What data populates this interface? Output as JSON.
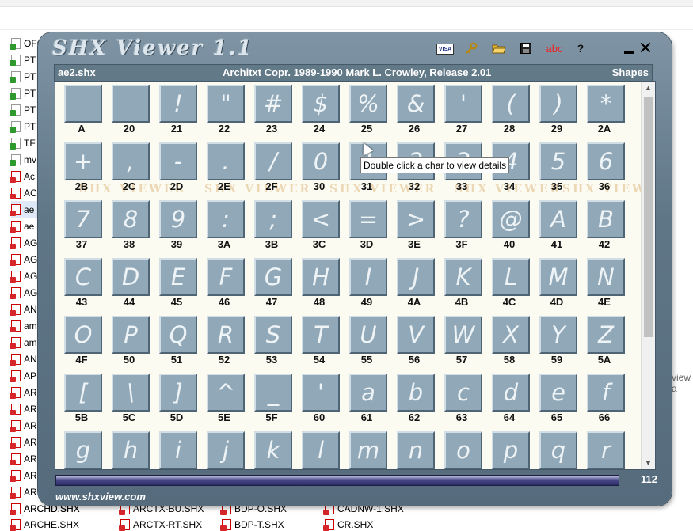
{
  "window": {
    "title": "SHX Viewer 1.1",
    "filename": "ae2.shx",
    "copyright": "Architxt Copr. 1989-1990 Mark L. Crowley, Release 2.01",
    "mode": "Shapes",
    "tooltip": "Double click a char to view details",
    "count": "112",
    "progress_fraction": 1.0,
    "url": "www.shxview.com",
    "watermark": "SHX VIEWER",
    "toolbar": {
      "visa_label": "VISA",
      "key_icon": "key-icon",
      "open_icon": "folder-open-icon",
      "save_icon": "floppy-save-icon",
      "abc_label": "abc",
      "help_label": "?"
    }
  },
  "glyph_cells": [
    {
      "glyph": "",
      "code": "A"
    },
    {
      "glyph": "",
      "code": "20"
    },
    {
      "glyph": "!",
      "code": "21"
    },
    {
      "glyph": "\"",
      "code": "22"
    },
    {
      "glyph": "#",
      "code": "23"
    },
    {
      "glyph": "$",
      "code": "24"
    },
    {
      "glyph": "%",
      "code": "25"
    },
    {
      "glyph": "&",
      "code": "26"
    },
    {
      "glyph": "'",
      "code": "27"
    },
    {
      "glyph": "(",
      "code": "28"
    },
    {
      "glyph": ")",
      "code": "29"
    },
    {
      "glyph": "*",
      "code": "2A"
    },
    {
      "glyph": "+",
      "code": "2B"
    },
    {
      "glyph": ",",
      "code": "2C"
    },
    {
      "glyph": "-",
      "code": "2D"
    },
    {
      "glyph": ".",
      "code": "2E"
    },
    {
      "glyph": "/",
      "code": "2F"
    },
    {
      "glyph": "0",
      "code": "30"
    },
    {
      "glyph": "1",
      "code": "31"
    },
    {
      "glyph": "2",
      "code": "32"
    },
    {
      "glyph": "3",
      "code": "33"
    },
    {
      "glyph": "4",
      "code": "34"
    },
    {
      "glyph": "5",
      "code": "35"
    },
    {
      "glyph": "6",
      "code": "36"
    },
    {
      "glyph": "7",
      "code": "37"
    },
    {
      "glyph": "8",
      "code": "38"
    },
    {
      "glyph": "9",
      "code": "39"
    },
    {
      "glyph": ":",
      "code": "3A"
    },
    {
      "glyph": ";",
      "code": "3B"
    },
    {
      "glyph": "<",
      "code": "3C"
    },
    {
      "glyph": "=",
      "code": "3D"
    },
    {
      "glyph": ">",
      "code": "3E"
    },
    {
      "glyph": "?",
      "code": "3F"
    },
    {
      "glyph": "@",
      "code": "40"
    },
    {
      "glyph": "A",
      "code": "41"
    },
    {
      "glyph": "B",
      "code": "42"
    },
    {
      "glyph": "C",
      "code": "43"
    },
    {
      "glyph": "D",
      "code": "44"
    },
    {
      "glyph": "E",
      "code": "45"
    },
    {
      "glyph": "F",
      "code": "46"
    },
    {
      "glyph": "G",
      "code": "47"
    },
    {
      "glyph": "H",
      "code": "48"
    },
    {
      "glyph": "I",
      "code": "49"
    },
    {
      "glyph": "J",
      "code": "4A"
    },
    {
      "glyph": "K",
      "code": "4B"
    },
    {
      "glyph": "L",
      "code": "4C"
    },
    {
      "glyph": "M",
      "code": "4D"
    },
    {
      "glyph": "N",
      "code": "4E"
    },
    {
      "glyph": "O",
      "code": "4F"
    },
    {
      "glyph": "P",
      "code": "50"
    },
    {
      "glyph": "Q",
      "code": "51"
    },
    {
      "glyph": "R",
      "code": "52"
    },
    {
      "glyph": "S",
      "code": "53"
    },
    {
      "glyph": "T",
      "code": "54"
    },
    {
      "glyph": "U",
      "code": "55"
    },
    {
      "glyph": "V",
      "code": "56"
    },
    {
      "glyph": "W",
      "code": "57"
    },
    {
      "glyph": "X",
      "code": "58"
    },
    {
      "glyph": "Y",
      "code": "59"
    },
    {
      "glyph": "Z",
      "code": "5A"
    },
    {
      "glyph": "[",
      "code": "5B"
    },
    {
      "glyph": "\\",
      "code": "5C"
    },
    {
      "glyph": "]",
      "code": "5D"
    },
    {
      "glyph": "^",
      "code": "5E"
    },
    {
      "glyph": "_",
      "code": "5F"
    },
    {
      "glyph": "'",
      "code": "60"
    },
    {
      "glyph": "a",
      "code": "61"
    },
    {
      "glyph": "b",
      "code": "62"
    },
    {
      "glyph": "c",
      "code": "63"
    },
    {
      "glyph": "d",
      "code": "64"
    },
    {
      "glyph": "e",
      "code": "65"
    },
    {
      "glyph": "f",
      "code": "66"
    },
    {
      "glyph": "g",
      "code": ""
    },
    {
      "glyph": "h",
      "code": ""
    },
    {
      "glyph": "i",
      "code": ""
    },
    {
      "glyph": "j",
      "code": ""
    },
    {
      "glyph": "k",
      "code": ""
    },
    {
      "glyph": "l",
      "code": ""
    },
    {
      "glyph": "m",
      "code": ""
    },
    {
      "glyph": "n",
      "code": ""
    },
    {
      "glyph": "o",
      "code": ""
    },
    {
      "glyph": "p",
      "code": ""
    },
    {
      "glyph": "q",
      "code": ""
    },
    {
      "glyph": "r",
      "code": ""
    }
  ],
  "background_files": [
    {
      "name": "OFO",
      "icon": "g"
    },
    {
      "name": "PT",
      "icon": "g"
    },
    {
      "name": "PT",
      "icon": "g"
    },
    {
      "name": "PT",
      "icon": "g"
    },
    {
      "name": "PT",
      "icon": "g"
    },
    {
      "name": "PT",
      "icon": "g"
    },
    {
      "name": "TF",
      "icon": "g"
    },
    {
      "name": "mv",
      "icon": "g"
    },
    {
      "name": "Ac",
      "icon": "r"
    },
    {
      "name": "AC",
      "icon": "r"
    },
    {
      "name": "ae",
      "icon": "r"
    },
    {
      "name": "ae",
      "icon": "r"
    },
    {
      "name": "AG",
      "icon": "r"
    },
    {
      "name": "AG",
      "icon": "r"
    },
    {
      "name": "AG",
      "icon": "r"
    },
    {
      "name": "AG",
      "icon": "r"
    },
    {
      "name": "AN",
      "icon": "r"
    },
    {
      "name": "am",
      "icon": "r"
    },
    {
      "name": "am",
      "icon": "r"
    },
    {
      "name": "AN",
      "icon": "r"
    },
    {
      "name": "AP",
      "icon": "r"
    },
    {
      "name": "AR",
      "icon": "r"
    },
    {
      "name": "AR",
      "icon": "r"
    },
    {
      "name": "AR",
      "icon": "r"
    },
    {
      "name": "AR",
      "icon": "r"
    },
    {
      "name": "AR",
      "icon": "r"
    },
    {
      "name": "AR",
      "icon": "r"
    },
    {
      "name": "AR",
      "icon": "r"
    },
    {
      "name": "ARCHD.SHX",
      "icon": "r"
    }
  ],
  "bottom_files": [
    "ARCHD.SHX",
    "ARCTX-BU.SHX",
    "BDP-O.SHX",
    "CADNW-1.SHX",
    "ARCHE.SHX",
    "ARCTX-RT.SHX",
    "BDP-T.SHX",
    "CR.SHX"
  ],
  "right_fragment": "view a"
}
